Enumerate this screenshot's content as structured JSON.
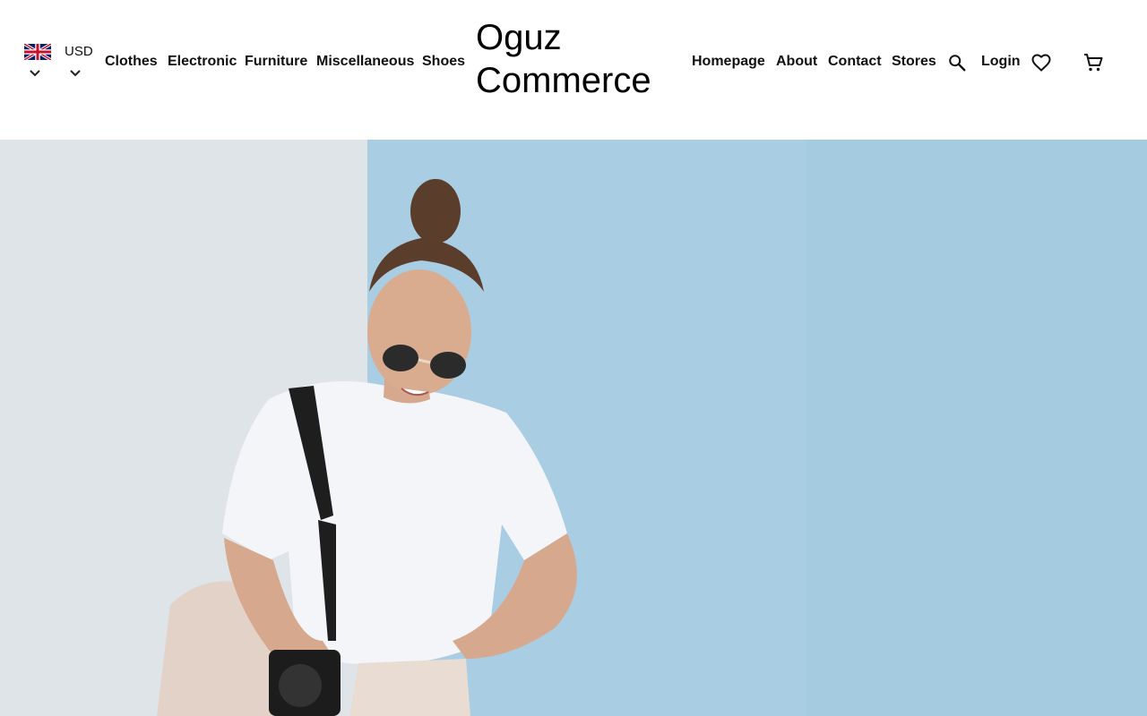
{
  "language": {
    "flag_icon": "uk-flag-icon",
    "dropdown_icon": "chevron-down-icon"
  },
  "currency": {
    "label": "USD",
    "dropdown_icon": "chevron-down-icon"
  },
  "categories": [
    "Clothes",
    "Electronic",
    "Furniture",
    "Miscellaneous",
    "Shoes"
  ],
  "brand": {
    "line1": "Oguz",
    "line2": "Commerce"
  },
  "nav": [
    "Homepage",
    "About",
    "Contact",
    "Stores"
  ],
  "actions": {
    "search_icon": "search-icon",
    "login_label": "Login",
    "wishlist_icon": "heart-icon",
    "cart_icon": "cart-icon"
  },
  "hero": {
    "image": "woman-with-camera-photo"
  },
  "colors": {
    "text": "#111111",
    "background": "#ffffff",
    "hero_wall_blue": "#a9cde3",
    "hero_wall_white": "#dfe4e8"
  }
}
